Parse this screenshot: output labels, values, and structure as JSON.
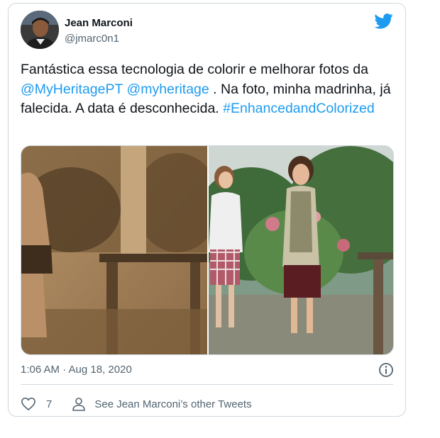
{
  "tweet": {
    "author_name": "Jean Marconi",
    "author_handle": "@jmarc0n1",
    "text_parts": {
      "p1": "Fantástica essa tecnologia de colorir e melhorar fotos da ",
      "mention1": "@MyHeritagePT",
      "sp": " ",
      "mention2": "@myheritage",
      "p2": " . Na foto, minha madrinha, já falecida. A data é desconhecida. ",
      "hashtag": "#EnhancedandColorized"
    },
    "timestamp": "1:06 AM · Aug 18, 2020",
    "likes": "7",
    "other_tweets_label": "See Jean Marconi’s other Tweets"
  },
  "icons": {
    "logo": "twitter-bird-icon",
    "info": "info-icon",
    "like": "heart-icon",
    "profile": "person-icon"
  },
  "colors": {
    "link": "#1d9bf0",
    "text": "#0f1419",
    "muted": "#536471",
    "border": "#cfd9de"
  }
}
